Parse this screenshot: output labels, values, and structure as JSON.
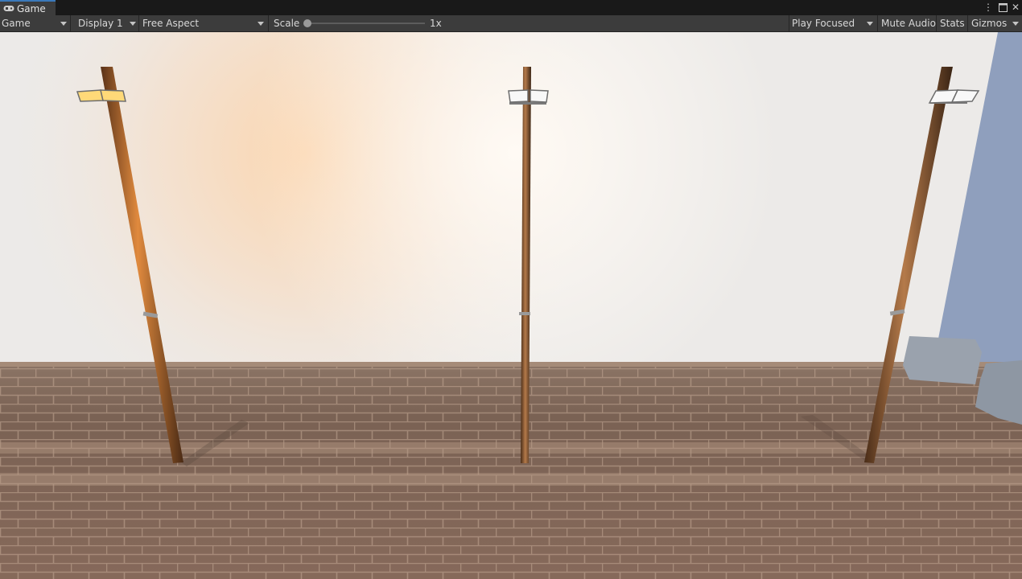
{
  "window": {
    "tab_label": "Game",
    "tab_icon": "gamepad-icon"
  },
  "window_controls": {
    "more": "more-options-icon",
    "maximize": "maximize-icon",
    "close": "close-icon"
  },
  "toolbar": {
    "view_mode": "Game",
    "display": "Display 1",
    "aspect": "Free Aspect",
    "scale_label": "Scale",
    "scale_value": "1x",
    "scale_fraction": 0.0,
    "play_mode": "Play Focused",
    "mute_audio": "Mute Audio",
    "stats": "Stats",
    "gizmos": "Gizmos"
  },
  "scene": {
    "lamp_colors": {
      "warm": "#ffd978",
      "white": "#f4f4f4",
      "pole": "#8a5a34"
    },
    "wall_color": "#efece7",
    "floor_color": "#7e6656",
    "side_wall_color": "#8ea0c0"
  }
}
